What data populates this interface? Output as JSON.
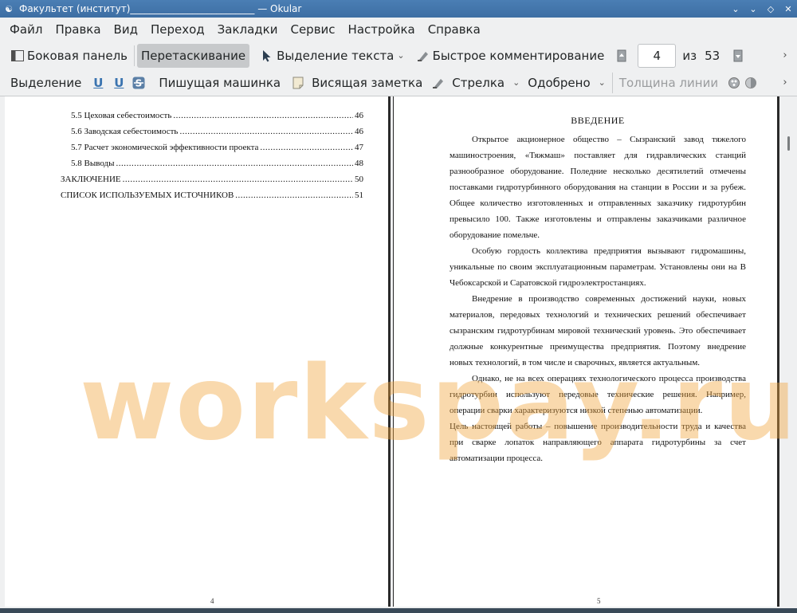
{
  "window": {
    "title": "Факультет (институт)__________________________ — Okular"
  },
  "menu": [
    "Файл",
    "Правка",
    "Вид",
    "Переход",
    "Закладки",
    "Сервис",
    "Настройка",
    "Справка"
  ],
  "toolbar1": {
    "sidebar": "Боковая панель",
    "browse": "Перетаскивание",
    "text_select": "Выделение текста",
    "quick_annot": "Быстрое комментирование",
    "page_current": "4",
    "page_of": "из",
    "page_total": "53"
  },
  "toolbar2": {
    "highlight": "Выделение",
    "typewriter": "Пишущая машинка",
    "popup_note": "Висящая заметка",
    "arrow": "Стрелка",
    "approved": "Одобрено",
    "line_width": "Толщина линии"
  },
  "left_page": {
    "toc": [
      {
        "label": "5.5 Цеховая себестоимость",
        "page": "46"
      },
      {
        "label": "5.6 Заводская себестоимость",
        "page": "46"
      },
      {
        "label": "5.7 Расчет экономической эффективности проекта",
        "page": "47"
      },
      {
        "label": "5.8 Выводы",
        "page": "48"
      },
      {
        "label": "ЗАКЛЮЧЕНИЕ",
        "page": "50"
      },
      {
        "label": "СПИСОК ИСПОЛЬЗУЕМЫХ ИСТОЧНИКОВ",
        "page": "51"
      }
    ],
    "page_number": "4"
  },
  "right_page": {
    "heading": "ВВЕДЕНИЕ",
    "paragraphs": [
      "Открытое акционерное общество – Сызранский завод тяжелого машиностроения, «Тяжмаш» поставляет для гидравлических станций разнообразное оборудование. Поледние несколько десятилетий отмечены поставками гидротурбинного оборудования на станции в России и за рубеж. Общее количество изготовленных и отправленных заказчику гидротурбин превысило 100. Также изготовлены и отправлены заказчиками различное оборудование помельче.",
      "Особую гордость коллектива предприятия вызывают гидромашины, уникальные по своим эксплуатационным параметрам. Установлены они на В Чебоксарской и Саратовской гидроэлектростанциях.",
      "Внедрение в производство современных достижений науки, новых материалов, передовых технологий и технических решений обеспечивает сызранским гидротурбинам мировой технический уровень. Это обеспечивает должные конкурентные преимущества предприятия. Поэтому внедрение новых технологий, в том числе и сварочных, является актуальным.",
      "Однако, не на всех операциях технологического процесса производства гидротурбин используют передовые технические решения. Например, операции сварки характеризуются низкой степенью автоматизации.",
      "Цель настоящей работы – повышение производительности труда и качества при сварке лопаток направляющего аппарата гидротурбины за счет автоматизации процесса."
    ],
    "page_number": "5"
  },
  "watermark": "workspay.ru"
}
